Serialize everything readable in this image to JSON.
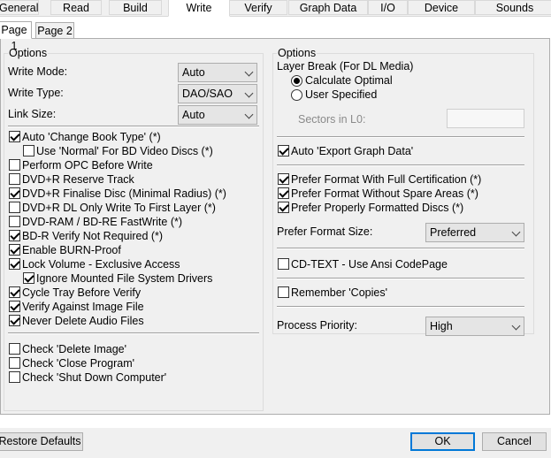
{
  "tabs": [
    "General",
    "Read",
    "Build",
    "Write",
    "Verify",
    "Graph Data",
    "I/O",
    "Device",
    "Sounds"
  ],
  "active_tab": "Write",
  "subtabs": [
    "Page 1",
    "Page 2"
  ],
  "left": {
    "title": "Options",
    "write_mode_label": "Write Mode:",
    "write_mode_value": "Auto",
    "write_type_label": "Write Type:",
    "write_type_value": "DAO/SAO",
    "link_size_label": "Link Size:",
    "link_size_value": "Auto",
    "checks": [
      {
        "label": "Auto 'Change Book Type' (*)",
        "checked": true
      },
      {
        "label": "Use 'Normal' For BD Video Discs (*)",
        "checked": false
      },
      {
        "label": "Perform OPC Before Write",
        "checked": false
      },
      {
        "label": "DVD+R Reserve Track",
        "checked": false
      },
      {
        "label": "DVD+R Finalise Disc (Minimal Radius) (*)",
        "checked": true
      },
      {
        "label": "DVD+R DL Only Write To First Layer (*)",
        "checked": false
      },
      {
        "label": "DVD-RAM / BD-RE FastWrite (*)",
        "checked": false
      },
      {
        "label": "BD-R Verify Not Required (*)",
        "checked": true
      },
      {
        "label": "Enable BURN-Proof",
        "checked": true
      },
      {
        "label": "Lock Volume - Exclusive Access",
        "checked": true
      },
      {
        "label": "Ignore Mounted File System Drivers",
        "checked": true
      },
      {
        "label": "Cycle Tray Before Verify",
        "checked": true
      },
      {
        "label": "Verify Against Image File",
        "checked": true
      },
      {
        "label": "Never Delete Audio Files",
        "checked": true
      },
      {
        "label": "Check 'Delete Image'",
        "checked": false
      },
      {
        "label": "Check 'Close Program'",
        "checked": false
      },
      {
        "label": "Check 'Shut Down Computer'",
        "checked": false
      }
    ]
  },
  "right": {
    "title": "Options",
    "layer_break_label": "Layer Break (For DL Media)",
    "radio_calculate": "Calculate Optimal",
    "radio_user": "User Specified",
    "sectors_label": "Sectors in L0:",
    "auto_export_label": "Auto 'Export Graph Data'",
    "prefer_full_cert": "Prefer Format With Full Certification (*)",
    "prefer_no_spare": "Prefer Format Without Spare Areas (*)",
    "prefer_properly": "Prefer Properly Formatted Discs (*)",
    "prefer_size_label": "Prefer Format Size:",
    "prefer_size_value": "Preferred",
    "cd_text_label": "CD-TEXT - Use Ansi CodePage",
    "remember_copies_label": "Remember 'Copies'",
    "priority_label": "Process Priority:",
    "priority_value": "High"
  },
  "buttons": {
    "restore": "Restore Defaults",
    "ok": "OK",
    "cancel": "Cancel"
  }
}
